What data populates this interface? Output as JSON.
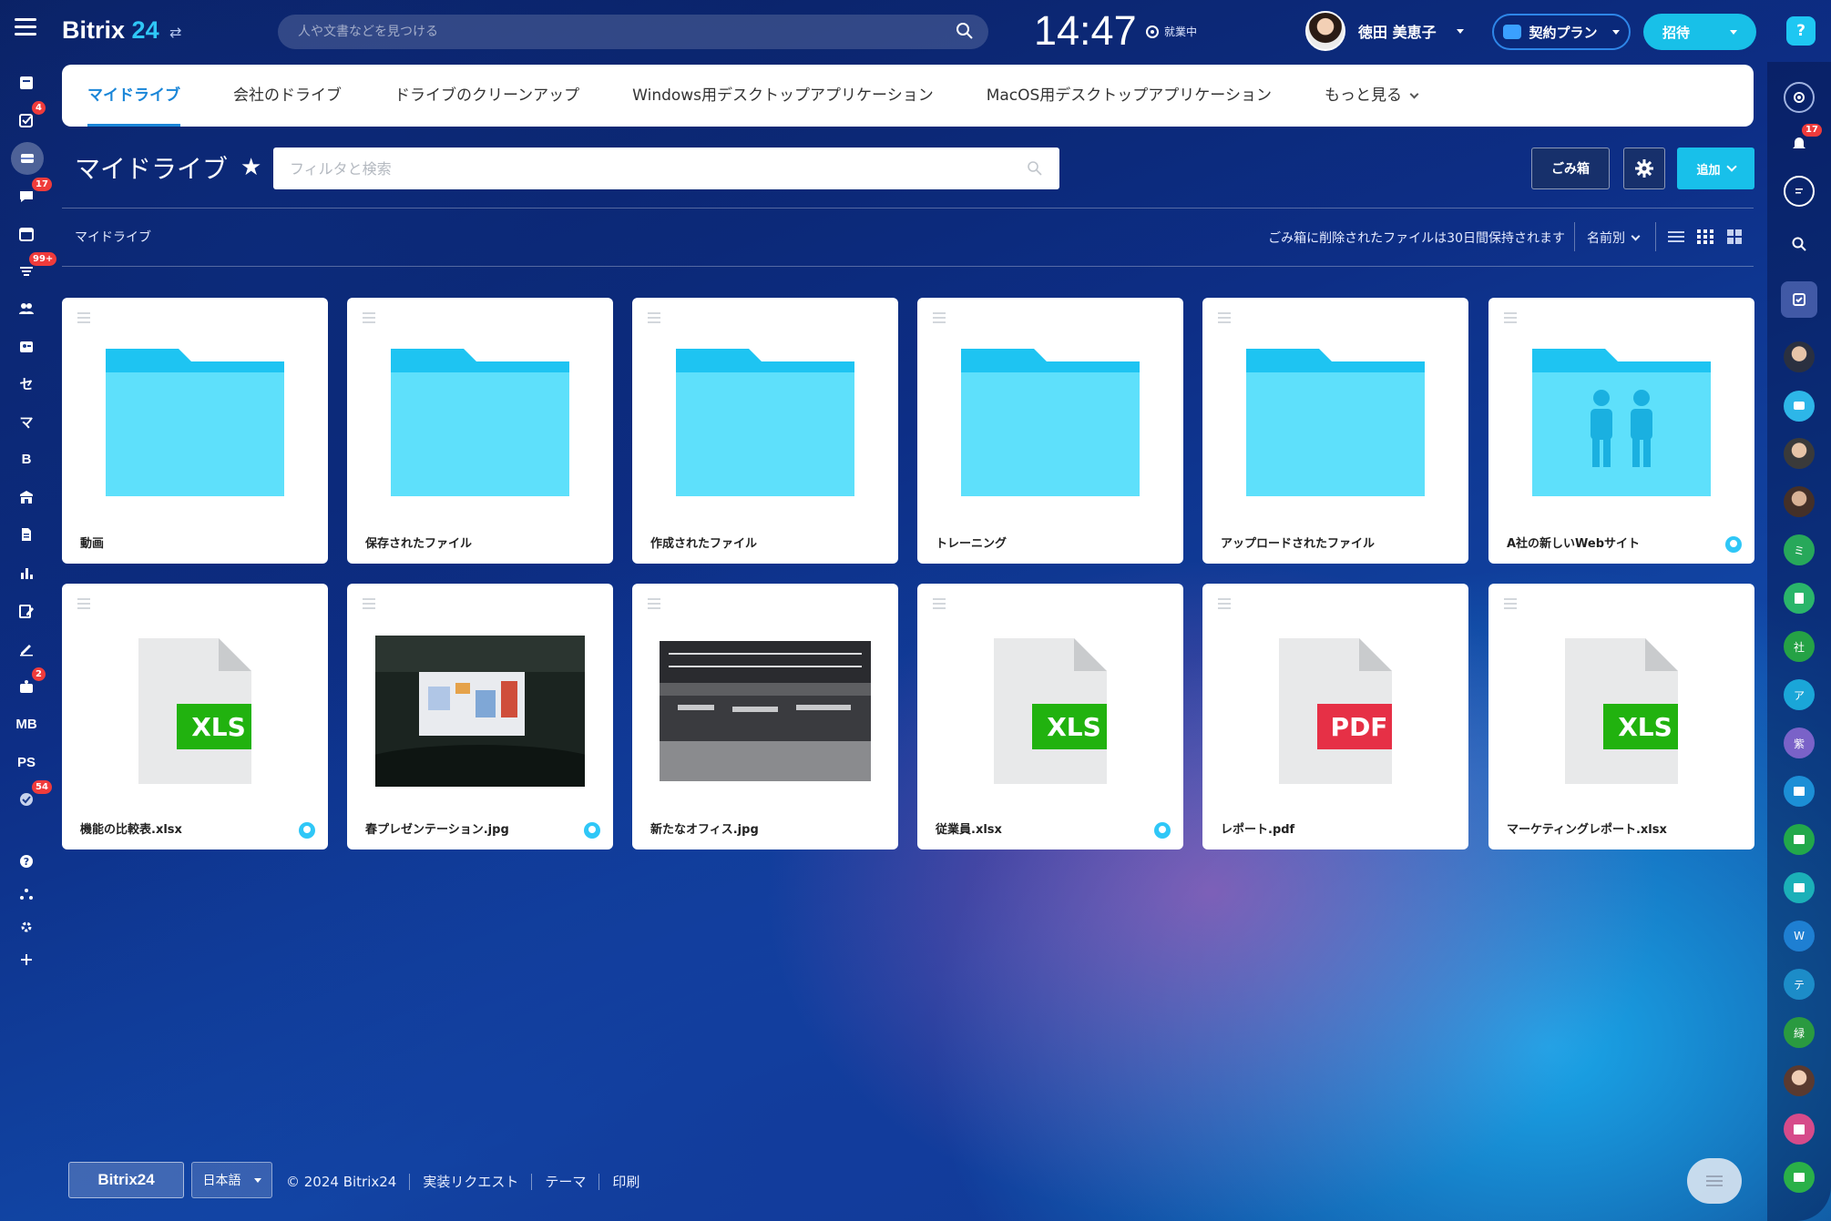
{
  "header": {
    "logo_text": "Bitrix",
    "logo_num": "24",
    "search_placeholder": "人や文書などを見つける",
    "clock": "14:47",
    "work_status": "就業中",
    "user_name": "徳田 美恵子",
    "plan_label": "契約プラン",
    "invite_label": "招待",
    "help_label": "?"
  },
  "left_sidebar": {
    "badges": {
      "tasks": "4",
      "chat": "17",
      "feed": "99+",
      "crm": "2",
      "misc": "54"
    },
    "text_items": {
      "se": "セ",
      "ma": "マ",
      "b": "B",
      "mb": "MB",
      "ps": "PS"
    }
  },
  "right_sidebar": {
    "notification_badge": "17",
    "contacts": [
      "ミ",
      "社",
      "ア",
      "紫",
      "W",
      "テ",
      "緑"
    ]
  },
  "tabs": [
    {
      "label": "マイドライブ"
    },
    {
      "label": "会社のドライブ"
    },
    {
      "label": "ドライブのクリーンアップ"
    },
    {
      "label": "Windows用デスクトップアプリケーション"
    },
    {
      "label": "MacOS用デスクトップアプリケーション"
    },
    {
      "label": "もっと見る"
    }
  ],
  "toolbar": {
    "title": "マイドライブ",
    "filter_placeholder": "フィルタと検索",
    "trash_label": "ごみ箱",
    "add_label": "追加"
  },
  "info_bar": {
    "breadcrumb": "マイドライブ",
    "trash_note": "ごみ箱に削除されたファイルは30日間保持されます",
    "sort_label": "名前別"
  },
  "files": [
    {
      "name": "動画",
      "type": "folder",
      "shared": false
    },
    {
      "name": "保存されたファイル",
      "type": "folder",
      "shared": false
    },
    {
      "name": "作成されたファイル",
      "type": "folder",
      "shared": false
    },
    {
      "name": "トレーニング",
      "type": "folder",
      "shared": false
    },
    {
      "name": "アップロードされたファイル",
      "type": "folder",
      "shared": false
    },
    {
      "name": "A社の新しいWebサイト",
      "type": "shared-folder",
      "shared": true
    },
    {
      "name": "機能の比較表.xlsx",
      "type": "xls",
      "badge": "XLS",
      "shared": true
    },
    {
      "name": "春プレゼンテーション.jpg",
      "type": "image",
      "shared": true
    },
    {
      "name": "新たなオフィス.jpg",
      "type": "image",
      "shared": false
    },
    {
      "name": "従業員.xlsx",
      "type": "xls",
      "badge": "XLS",
      "shared": true
    },
    {
      "name": "レポート.pdf",
      "type": "pdf",
      "badge": "PDF",
      "shared": false
    },
    {
      "name": "マーケティングレポート.xlsx",
      "type": "xls",
      "badge": "XLS",
      "shared": false
    }
  ],
  "footer": {
    "logo": "Bitrix24",
    "language": "日本語",
    "copyright": "© 2024 Bitrix24",
    "links": [
      "実装リクエスト",
      "テーマ",
      "印刷"
    ]
  },
  "colors": {
    "accent": "#18c0ea",
    "folder": "#5ee0fb",
    "folder_tab": "#1ec4f2",
    "xls": "#21b20f",
    "pdf": "#e63046"
  }
}
